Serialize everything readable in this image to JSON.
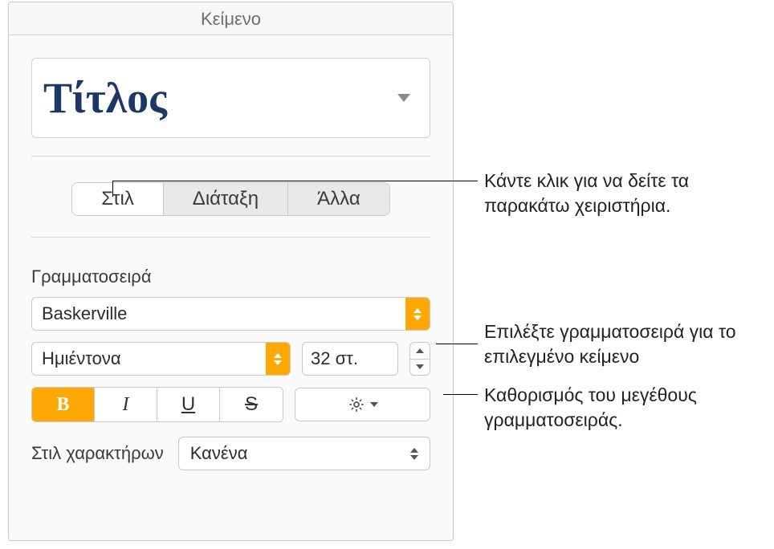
{
  "header": {
    "title": "Κείμενο"
  },
  "paragraphStyle": {
    "name": "Τίτλος"
  },
  "tabs": {
    "items": [
      "Στιλ",
      "Διάταξη",
      "Άλλα"
    ],
    "active_index": 0
  },
  "font": {
    "section_label": "Γραμματοσειρά",
    "family": "Baskerville",
    "weight": "Ημιέντονα",
    "size_display": "32 στ.",
    "bold_label": "B",
    "italic_label": "I",
    "underline_label": "U",
    "strike_label": "S",
    "bold_active": true
  },
  "char_styles": {
    "label": "Στιλ χαρακτήρων",
    "value": "Κανένα"
  },
  "callouts": {
    "tabs": "Κάντε κλικ για να δείτε τα παρακάτω χειριστήρια.",
    "font_family": "Επιλέξτε γραμματοσειρά για το επιλεγμένο κείμενο",
    "font_size": "Καθορισμός του μεγέθους γραμματοσειράς."
  }
}
